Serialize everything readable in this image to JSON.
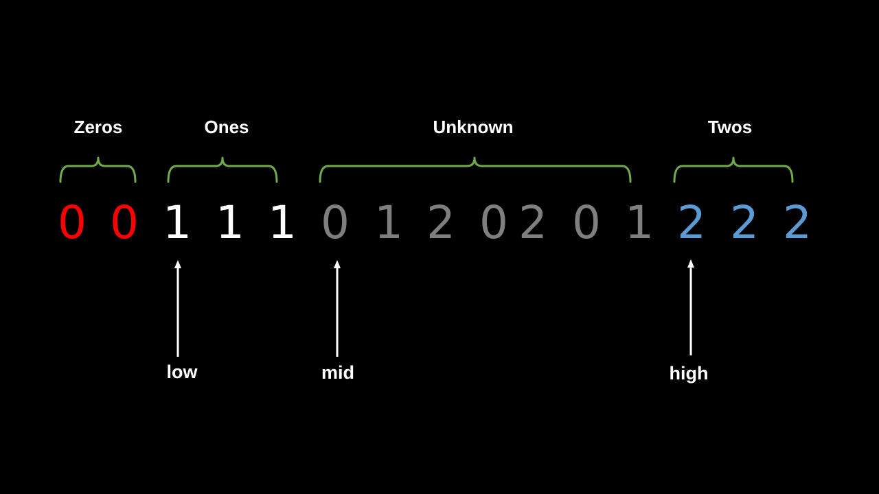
{
  "groups": [
    {
      "label": "Zeros"
    },
    {
      "label": "Ones"
    },
    {
      "label": "Unknown"
    },
    {
      "label": "Twos"
    }
  ],
  "array": [
    {
      "value": "0",
      "category": "zero"
    },
    {
      "value": "0",
      "category": "zero"
    },
    {
      "value": "1",
      "category": "one"
    },
    {
      "value": "1",
      "category": "one"
    },
    {
      "value": "1",
      "category": "one"
    },
    {
      "value": "0",
      "category": "unknown"
    },
    {
      "value": "1",
      "category": "unknown"
    },
    {
      "value": "2",
      "category": "unknown"
    },
    {
      "value": "0",
      "category": "unknown"
    },
    {
      "value": "2",
      "category": "unknown"
    },
    {
      "value": "0",
      "category": "unknown"
    },
    {
      "value": "1",
      "category": "unknown"
    },
    {
      "value": "2",
      "category": "two"
    },
    {
      "value": "2",
      "category": "two"
    },
    {
      "value": "2",
      "category": "two"
    }
  ],
  "pointers": [
    {
      "label": "low"
    },
    {
      "label": "mid"
    },
    {
      "label": "high"
    }
  ],
  "colors": {
    "background": "#000000",
    "zero": "#ff0000",
    "one": "#ffffff",
    "unknown": "#7f7f7f",
    "two": "#5b9bd5",
    "brace": "#70ad47",
    "arrow": "#ffffff"
  }
}
